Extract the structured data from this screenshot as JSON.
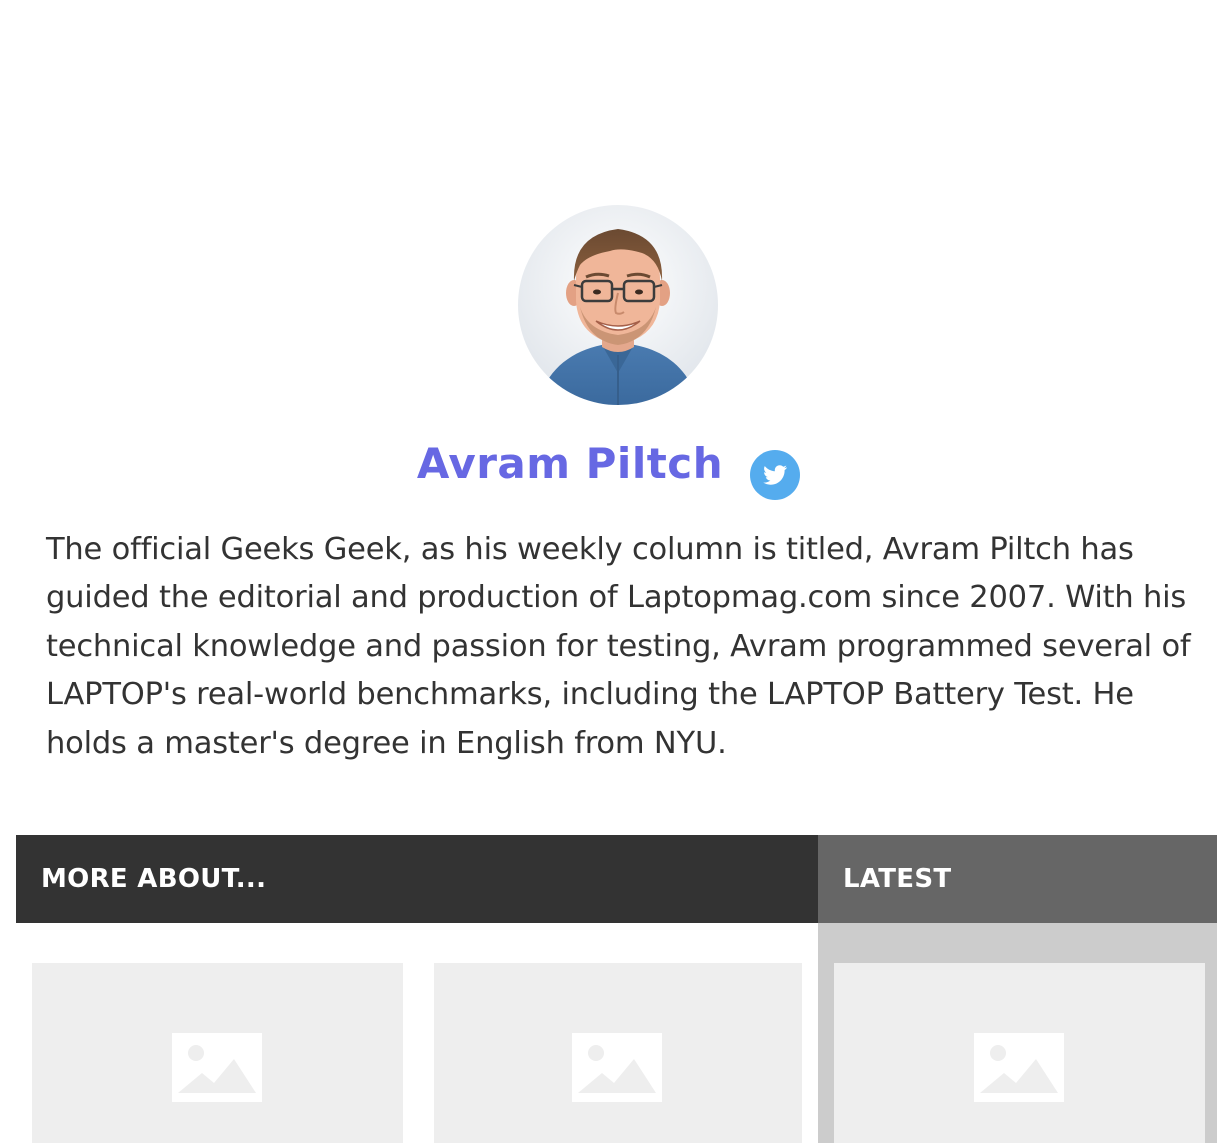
{
  "author": {
    "name": "Avram Piltch",
    "bio": "The official Geeks Geek, as his weekly column is titled, Avram Piltch has guided the editorial and production of Laptopmag.com since 2007. With his technical knowledge and passion for testing, Avram programmed several of LAPTOP's real-world benchmarks, including the LAPTOP Battery Test. He holds a master's degree in English from NYU.",
    "social_icon": "twitter-icon",
    "avatar_icon": "author-photo"
  },
  "sections": {
    "more_about_title": "MORE ABOUT...",
    "latest_title": "LATEST"
  },
  "cards": {
    "more_about": [
      {
        "image": "image-placeholder-icon"
      },
      {
        "image": "image-placeholder-icon"
      }
    ],
    "latest": [
      {
        "image": "image-placeholder-icon"
      }
    ]
  },
  "colors": {
    "author_name": "#6768e3",
    "twitter": "#55acee",
    "bio_text": "#333333",
    "more_header_bg": "#333333",
    "latest_header_bg": "#666666",
    "latest_panel_bg": "#cccccc",
    "card_bg": "#eeeeee",
    "placeholder_icon": "#ffffff"
  }
}
